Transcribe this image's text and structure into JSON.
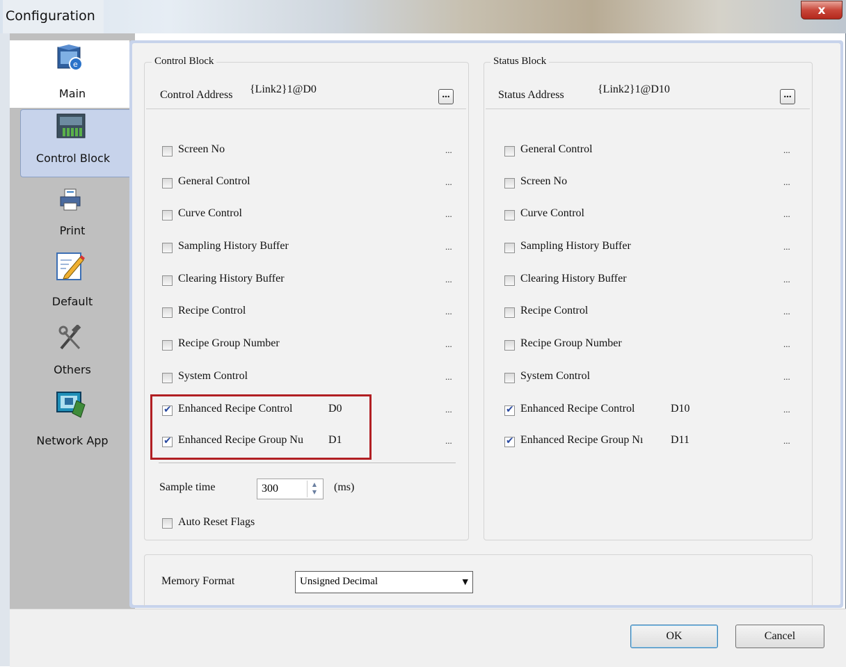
{
  "window": {
    "title": "Configuration",
    "close_label": "x"
  },
  "sidebar": {
    "items": [
      {
        "label": "Main",
        "icon": "monitor-globe-icon"
      },
      {
        "label": "Control Block",
        "icon": "control-panel-icon",
        "selected": true
      },
      {
        "label": "Print",
        "icon": "printer-icon"
      },
      {
        "label": "Default",
        "icon": "edit-pen-icon"
      },
      {
        "label": "Others",
        "icon": "tools-icon"
      },
      {
        "label": "Network App",
        "icon": "network-screen-icon"
      }
    ]
  },
  "control_block": {
    "group_title": "Control Block",
    "address_label": "Control Address",
    "address_value": "{Link2}1@D0",
    "browse_label": "...",
    "items": [
      {
        "label": "Screen No",
        "checked": false,
        "addr": ""
      },
      {
        "label": "General Control",
        "checked": false,
        "addr": ""
      },
      {
        "label": "Curve Control",
        "checked": false,
        "addr": ""
      },
      {
        "label": "Sampling History Buffer",
        "checked": false,
        "addr": ""
      },
      {
        "label": "Clearing History Buffer",
        "checked": false,
        "addr": ""
      },
      {
        "label": "Recipe Control",
        "checked": false,
        "addr": ""
      },
      {
        "label": "Recipe Group Number",
        "checked": false,
        "addr": ""
      },
      {
        "label": "System Control",
        "checked": false,
        "addr": ""
      },
      {
        "label": "Enhanced Recipe Control",
        "checked": true,
        "addr": "D0"
      },
      {
        "label": "Enhanced Recipe Group Nu",
        "checked": true,
        "addr": "D1"
      }
    ],
    "more_label": "...",
    "sample_time_label": "Sample time",
    "sample_time_value": "300",
    "sample_time_unit": "(ms)",
    "auto_reset_label": "Auto Reset Flags",
    "auto_reset_checked": false
  },
  "status_block": {
    "group_title": "Status Block",
    "address_label": "Status Address",
    "address_value": "{Link2}1@D10",
    "browse_label": "...",
    "items": [
      {
        "label": "General Control",
        "checked": false,
        "addr": ""
      },
      {
        "label": "Screen No",
        "checked": false,
        "addr": ""
      },
      {
        "label": "Curve Control",
        "checked": false,
        "addr": ""
      },
      {
        "label": "Sampling History Buffer",
        "checked": false,
        "addr": ""
      },
      {
        "label": "Clearing History Buffer",
        "checked": false,
        "addr": ""
      },
      {
        "label": "Recipe Control",
        "checked": false,
        "addr": ""
      },
      {
        "label": "Recipe Group Number",
        "checked": false,
        "addr": ""
      },
      {
        "label": "System Control",
        "checked": false,
        "addr": ""
      },
      {
        "label": "Enhanced Recipe Control",
        "checked": true,
        "addr": "D10"
      },
      {
        "label": "Enhanced Recipe Group Nı",
        "checked": true,
        "addr": "D11"
      }
    ],
    "more_label": "..."
  },
  "memory": {
    "label": "Memory Format",
    "value": "Unsigned Decimal"
  },
  "footer": {
    "ok_label": "OK",
    "cancel_label": "Cancel"
  },
  "colors": {
    "highlight": "#b11f23",
    "selected_tab": "#c7d3eb",
    "close_button": "#c9473a"
  }
}
